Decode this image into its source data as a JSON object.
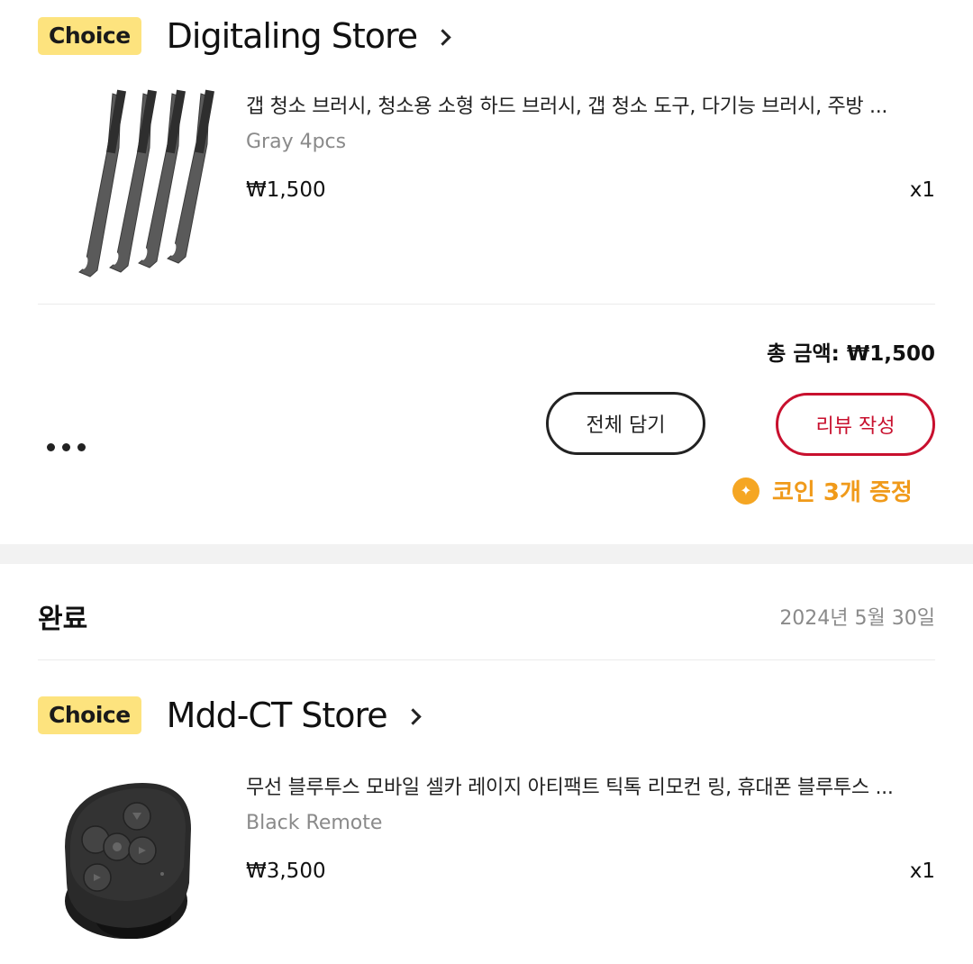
{
  "orders": [
    {
      "badge": "Choice",
      "store": "Digitaling Store",
      "product_title": "갭 청소 브러시, 청소용 소형 하드 브러시, 갭 청소 도구, 다기능 브러시, 주방 ...",
      "variant": "Gray 4pcs",
      "price": "₩1,500",
      "qty": "x1",
      "total": "총 금액: ₩1,500",
      "add_all_label": "전체 담기",
      "review_label": "리뷰 작성",
      "coin_text": "코인 3개 증정"
    },
    {
      "status": "완료",
      "date": "2024년 5월 30일",
      "badge": "Choice",
      "store": "Mdd-CT Store",
      "product_title": "무선 블루투스 모바일 셀카 레이지 아티팩트 틱톡 리모컨 링, 휴대폰 블루투스 ...",
      "variant": "Black Remote",
      "price": "₩3,500",
      "qty": "x1"
    }
  ],
  "colors": {
    "choice_badge": "#fde37e",
    "review_accent": "#c8102e",
    "coin_accent": "#f09a1a"
  },
  "icons": [
    "chevron-right-icon",
    "more-dots-icon",
    "coin-icon"
  ]
}
